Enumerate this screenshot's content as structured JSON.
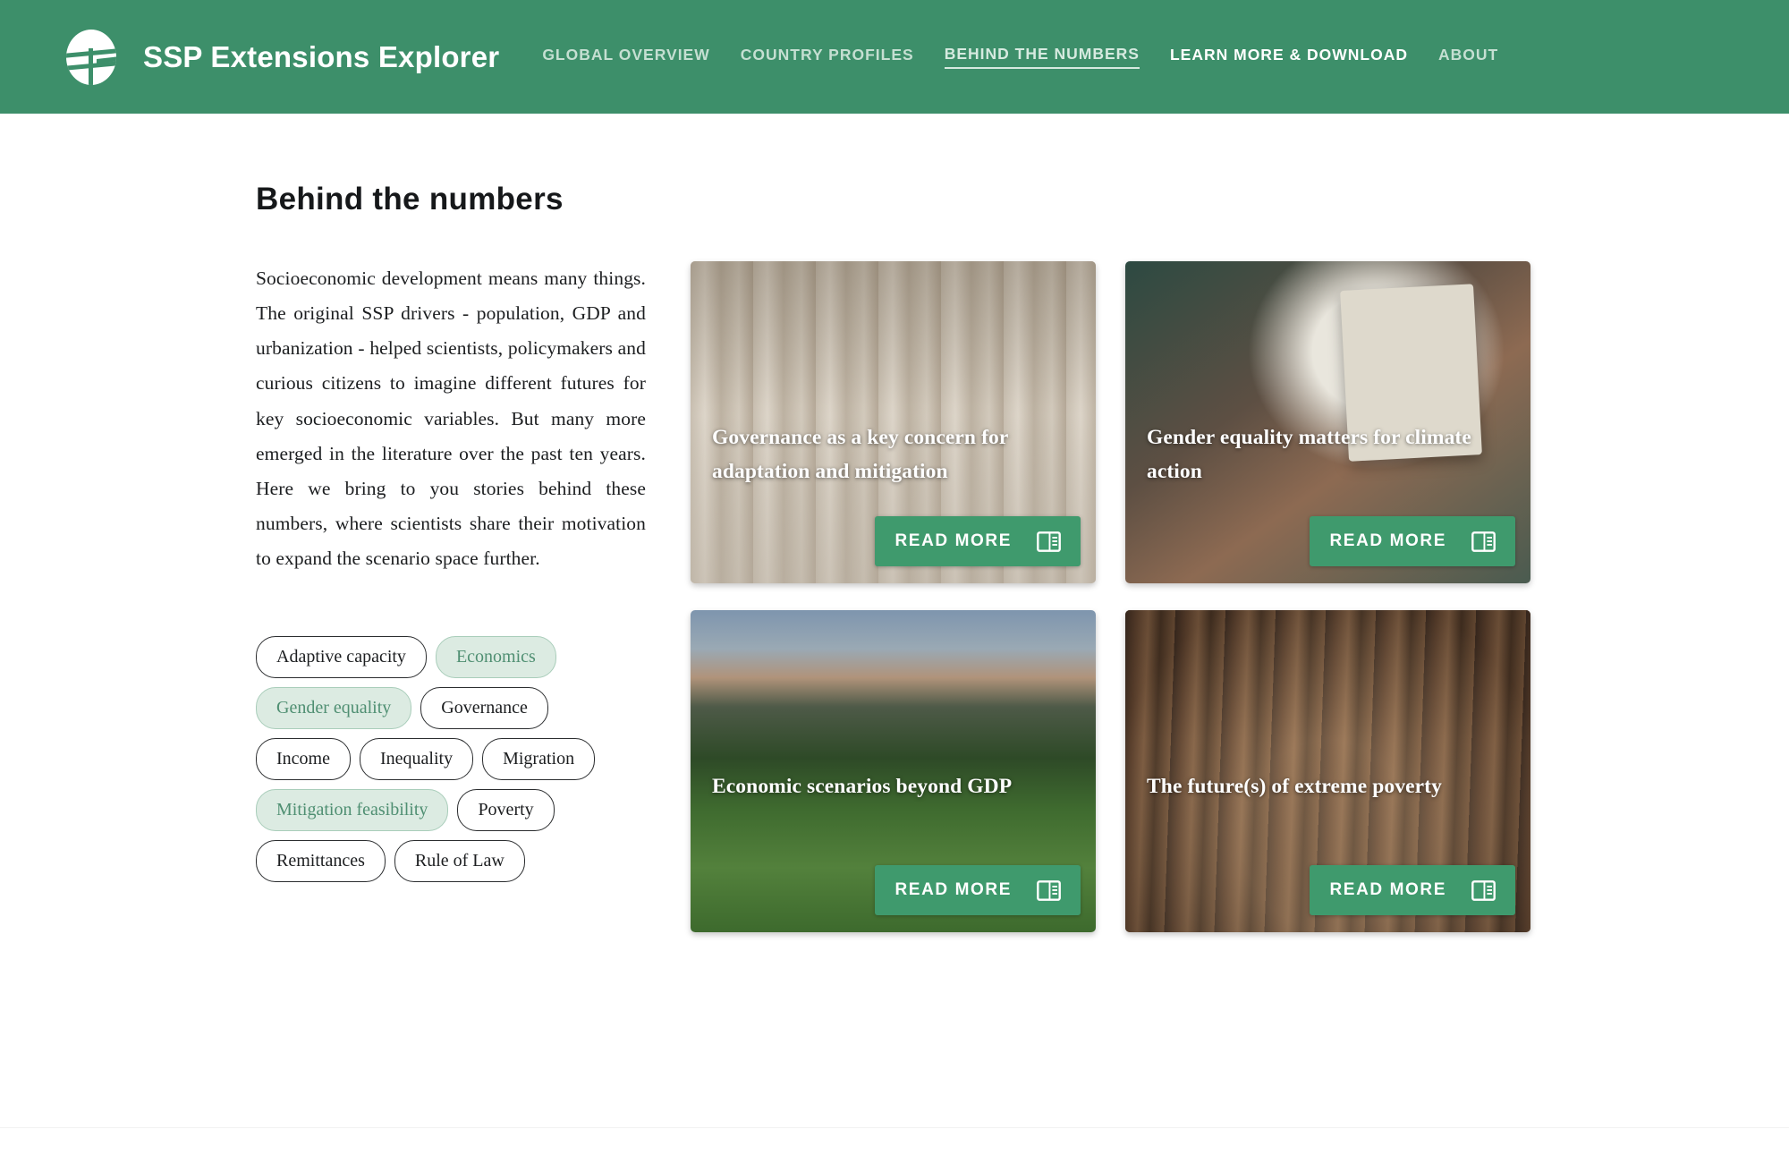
{
  "header": {
    "logo_icon": "ssp-globe-logo-icon",
    "brand_title": "SSP Extensions Explorer",
    "nav": [
      {
        "label": "GLOBAL OVERVIEW",
        "state": "default"
      },
      {
        "label": "COUNTRY PROFILES",
        "state": "default"
      },
      {
        "label": "BEHIND THE NUMBERS",
        "state": "active"
      },
      {
        "label": "LEARN MORE & DOWNLOAD",
        "state": "bright"
      },
      {
        "label": "ABOUT",
        "state": "default"
      }
    ],
    "colors": {
      "background": "#3d8f6a",
      "nav_text": "#c5dfd2",
      "active_text": "#d6eae0"
    }
  },
  "page": {
    "title": "Behind the numbers",
    "intro": "Socioeconomic development means many things. The original SSP drivers - population, GDP and urbanization - helped scientists, policymakers and curious citizens to imagine different futures for key socioeconomic variables. But many more emerged in the literature over the past ten years. Here we bring to you stories behind these numbers, where scientists share their motivation to expand the scenario space further."
  },
  "tags": [
    {
      "label": "Adaptive capacity",
      "selected": false
    },
    {
      "label": "Economics",
      "selected": true
    },
    {
      "label": "Gender equality",
      "selected": true
    },
    {
      "label": "Governance",
      "selected": false
    },
    {
      "label": "Income",
      "selected": false
    },
    {
      "label": "Inequality",
      "selected": false
    },
    {
      "label": "Migration",
      "selected": false
    },
    {
      "label": "Mitigation feasibility",
      "selected": true
    },
    {
      "label": "Poverty",
      "selected": false
    },
    {
      "label": "Remittances",
      "selected": false
    },
    {
      "label": "Rule of Law",
      "selected": false
    }
  ],
  "tag_colors": {
    "selected_background": "#dcebe2",
    "selected_text": "#4f8f72",
    "default_border": "#2b2d2f"
  },
  "cards": [
    {
      "title": "Governance as a key concern for adaptation and mitigation",
      "image_alt": "classical-columns-photo",
      "button_label": "READ MORE",
      "button_icon": "article-icon"
    },
    {
      "title": "Gender equality matters for climate action",
      "image_alt": "hand-holding-gender-symbol-card-photo",
      "button_label": "READ MORE",
      "button_icon": "article-icon"
    },
    {
      "title": "Economic scenarios beyond GDP",
      "image_alt": "grain-silos-and-field-photo",
      "button_label": "READ MORE",
      "button_icon": "article-icon"
    },
    {
      "title": "The future(s) of extreme poverty",
      "image_alt": "informal-settlement-alley-photo",
      "button_label": "READ MORE",
      "button_icon": "article-icon"
    }
  ],
  "button_color": "#3f9a6d"
}
